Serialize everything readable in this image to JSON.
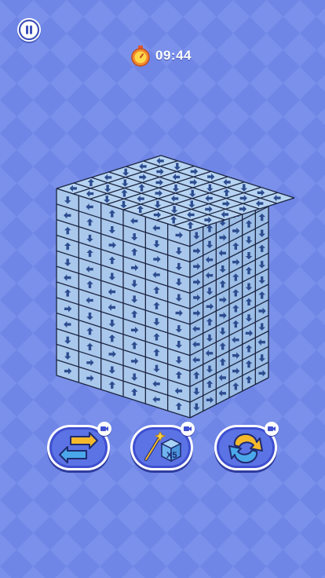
{
  "timer": {
    "text": "09:44",
    "icon": "stopwatch-icon"
  },
  "pause": {
    "icon": "pause-icon"
  },
  "game": {
    "background_colors": [
      "#6f86e6",
      "#7a90ea"
    ],
    "cube_colors": {
      "top": "#b6d4f2",
      "left": "#a9c8ec",
      "right": "#9dbfe7",
      "grid": "#1c2440",
      "arrow": "#2d4c8f"
    },
    "arrow_directions": [
      "up",
      "down",
      "left",
      "right"
    ]
  },
  "powerups": [
    {
      "name": "swap",
      "icon": "swap-arrows-icon",
      "ad_icon": "video-ad-icon"
    },
    {
      "name": "magic",
      "icon": "magic-wand-cube-icon",
      "label": "X5",
      "ad_icon": "video-ad-icon"
    },
    {
      "name": "rotate",
      "icon": "rotate-arrows-icon",
      "ad_icon": "video-ad-icon"
    }
  ]
}
